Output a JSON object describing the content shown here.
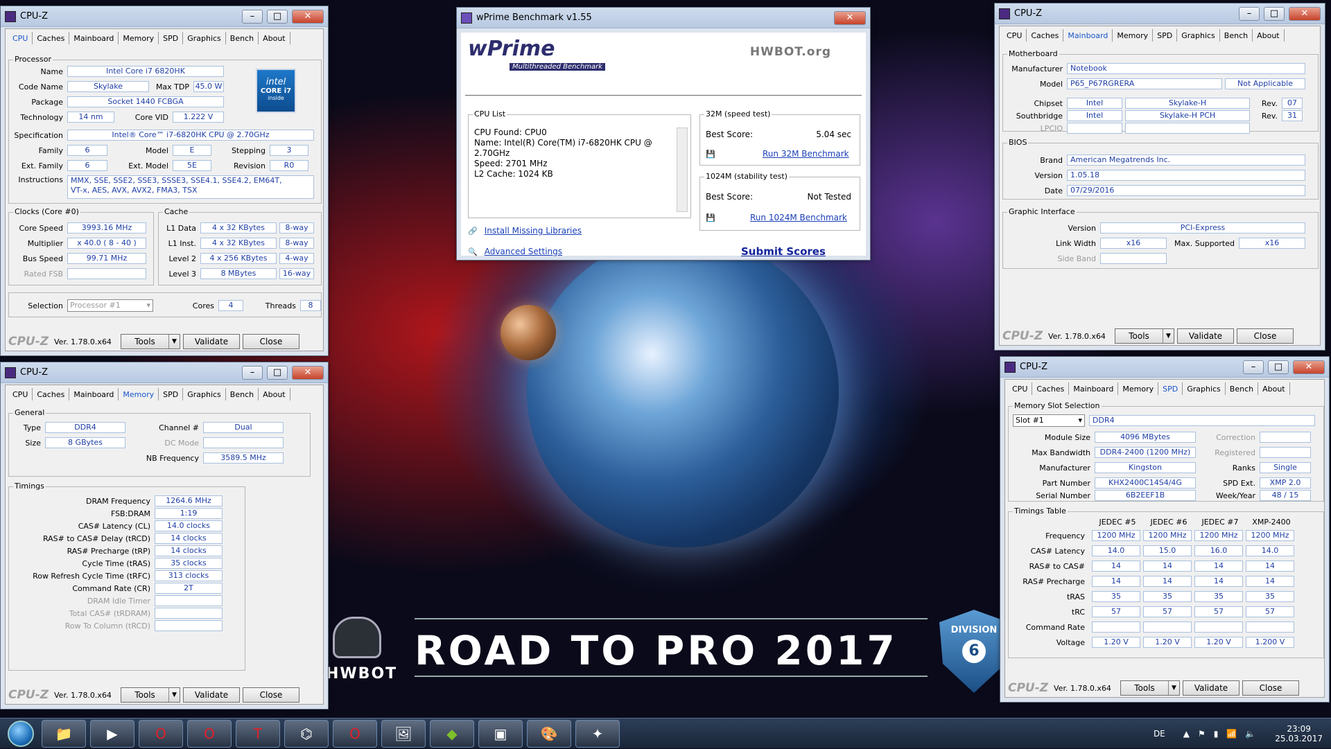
{
  "desktop": {
    "road_text": "ROAD TO PRO 2017",
    "hwbot_text": "HWBOT",
    "division_label": "DIVISION",
    "division_num": "6"
  },
  "cpuz_common": {
    "logo": "CPU-Z",
    "version": "Ver. 1.78.0.x64",
    "tools": "Tools",
    "validate": "Validate",
    "close": "Close",
    "title": "CPU-Z",
    "tabs": [
      "CPU",
      "Caches",
      "Mainboard",
      "Memory",
      "SPD",
      "Graphics",
      "Bench",
      "About"
    ]
  },
  "cpu": {
    "processor_label": "Processor",
    "name_label": "Name",
    "name": "Intel Core i7 6820HK",
    "codename_label": "Code Name",
    "codename": "Skylake",
    "maxtdp_label": "Max TDP",
    "maxtdp": "45.0 W",
    "package_label": "Package",
    "package": "Socket 1440 FCBGA",
    "technology_label": "Technology",
    "technology": "14 nm",
    "corevid_label": "Core VID",
    "corevid": "1.222 V",
    "spec_label": "Specification",
    "spec": "Intel® Core™ i7-6820HK CPU @ 2.70GHz",
    "family_label": "Family",
    "family": "6",
    "model_label": "Model",
    "model": "E",
    "stepping_label": "Stepping",
    "stepping": "3",
    "extfamily_label": "Ext. Family",
    "extfamily": "6",
    "extmodel_label": "Ext. Model",
    "extmodel": "5E",
    "revision_label": "Revision",
    "revision": "R0",
    "instructions_label": "Instructions",
    "instructions1": "MMX, SSE, SSE2, SSE3, SSSE3, SSE4.1, SSE4.2, EM64T,",
    "instructions2": "VT-x, AES, AVX, AVX2, FMA3, TSX",
    "intel_line1": "intel",
    "intel_line2": "CORE i7",
    "intel_line3": "inside",
    "clocks_label": "Clocks (Core #0)",
    "corespeed_label": "Core Speed",
    "corespeed": "3993.16 MHz",
    "multiplier_label": "Multiplier",
    "multiplier": "x 40.0 ( 8 - 40 )",
    "busspeed_label": "Bus Speed",
    "busspeed": "99.71 MHz",
    "ratedfsb_label": "Rated FSB",
    "cache_label": "Cache",
    "l1data_label": "L1 Data",
    "l1data": "4 x 32 KBytes",
    "l1data_way": "8-way",
    "l1inst_label": "L1 Inst.",
    "l1inst": "4 x 32 KBytes",
    "l1inst_way": "8-way",
    "l2_label": "Level 2",
    "l2": "4 x 256 KBytes",
    "l2_way": "4-way",
    "l3_label": "Level 3",
    "l3": "8 MBytes",
    "l3_way": "16-way",
    "selection_label": "Selection",
    "selection": "Processor #1",
    "cores_label": "Cores",
    "cores": "4",
    "threads_label": "Threads",
    "threads": "8"
  },
  "memory": {
    "general_label": "General",
    "type_label": "Type",
    "type": "DDR4",
    "channel_label": "Channel #",
    "channel": "Dual",
    "size_label": "Size",
    "size": "8 GBytes",
    "dcmode_label": "DC Mode",
    "nbfreq_label": "NB Frequency",
    "nbfreq": "3589.5 MHz",
    "timings_label": "Timings",
    "rows": [
      {
        "label": "DRAM Frequency",
        "value": "1264.6 MHz",
        "gray": false
      },
      {
        "label": "FSB:DRAM",
        "value": "1:19",
        "gray": false
      },
      {
        "label": "CAS# Latency (CL)",
        "value": "14.0 clocks",
        "gray": false
      },
      {
        "label": "RAS# to CAS# Delay (tRCD)",
        "value": "14 clocks",
        "gray": false
      },
      {
        "label": "RAS# Precharge (tRP)",
        "value": "14 clocks",
        "gray": false
      },
      {
        "label": "Cycle Time (tRAS)",
        "value": "35 clocks",
        "gray": false
      },
      {
        "label": "Row Refresh Cycle Time (tRFC)",
        "value": "313 clocks",
        "gray": false
      },
      {
        "label": "Command Rate (CR)",
        "value": "2T",
        "gray": false
      },
      {
        "label": "DRAM Idle Timer",
        "value": "",
        "gray": true
      },
      {
        "label": "Total CAS# (tRDRAM)",
        "value": "",
        "gray": true
      },
      {
        "label": "Row To Column (tRCD)",
        "value": "",
        "gray": true
      }
    ]
  },
  "mainboard": {
    "mb_label": "Motherboard",
    "manufacturer_label": "Manufacturer",
    "manufacturer": "Notebook",
    "model_label": "Model",
    "model": "P65_P67RGRERA",
    "model2": "Not Applicable",
    "chipset_label": "Chipset",
    "chipset_vendor": "Intel",
    "chipset": "Skylake-H",
    "chipset_rev_label": "Rev.",
    "chipset_rev": "07",
    "southbridge_label": "Southbridge",
    "sb_vendor": "Intel",
    "sb": "Skylake-H PCH",
    "sb_rev_label": "Rev.",
    "sb_rev": "31",
    "lpcio_label": "LPCIO",
    "bios_label": "BIOS",
    "brand_label": "Brand",
    "brand": "American Megatrends Inc.",
    "version_label": "Version",
    "version": "1.05.18",
    "date_label": "Date",
    "date": "07/29/2016",
    "gi_label": "Graphic Interface",
    "giversion_label": "Version",
    "giversion": "PCI-Express",
    "linkwidth_label": "Link Width",
    "linkwidth": "x16",
    "maxsup_label": "Max. Supported",
    "maxsup": "x16",
    "sideband_label": "Side Band"
  },
  "spd": {
    "slot_label": "Memory Slot Selection",
    "slot": "Slot #1",
    "slot_type": "DDR4",
    "modsize_label": "Module Size",
    "modsize": "4096 MBytes",
    "correction_label": "Correction",
    "maxbw_label": "Max Bandwidth",
    "maxbw": "DDR4-2400 (1200 MHz)",
    "registered_label": "Registered",
    "manuf_label": "Manufacturer",
    "manuf": "Kingston",
    "ranks_label": "Ranks",
    "ranks": "Single",
    "part_label": "Part Number",
    "part": "KHX2400C14S4/4G",
    "spdext_label": "SPD Ext.",
    "spdext": "XMP 2.0",
    "serial_label": "Serial Number",
    "serial": "6B2EEF1B",
    "week_label": "Week/Year",
    "week": "48 / 15",
    "tt_label": "Timings Table",
    "cols": [
      "JEDEC #5",
      "JEDEC #6",
      "JEDEC #7",
      "XMP-2400"
    ],
    "trows": [
      {
        "label": "Frequency",
        "v": [
          "1200 MHz",
          "1200 MHz",
          "1200 MHz",
          "1200 MHz"
        ]
      },
      {
        "label": "CAS# Latency",
        "v": [
          "14.0",
          "15.0",
          "16.0",
          "14.0"
        ]
      },
      {
        "label": "RAS# to CAS#",
        "v": [
          "14",
          "14",
          "14",
          "14"
        ]
      },
      {
        "label": "RAS# Precharge",
        "v": [
          "14",
          "14",
          "14",
          "14"
        ]
      },
      {
        "label": "tRAS",
        "v": [
          "35",
          "35",
          "35",
          "35"
        ]
      },
      {
        "label": "tRC",
        "v": [
          "57",
          "57",
          "57",
          "57"
        ]
      },
      {
        "label": "Command Rate",
        "v": [
          "",
          "",
          "",
          ""
        ]
      },
      {
        "label": "Voltage",
        "v": [
          "1.20 V",
          "1.20 V",
          "1.20 V",
          "1.200 V"
        ]
      }
    ]
  },
  "wprime": {
    "title": "wPrime Benchmark v1.55",
    "logo": "wPrime",
    "sub": "Multithreaded Benchmark",
    "hwbot": "HWBOT.org",
    "cpulist_label": "CPU List",
    "cpulist": [
      "CPU Found: CPU0",
      "Name:   Intel(R) Core(TM) i7-6820HK CPU @",
      "2.70GHz",
      "Speed:  2701 MHz",
      "L2 Cache: 1024 KB"
    ],
    "t32_label": "32M (speed test)",
    "best_label": "Best Score:",
    "t32_score": "5.04 sec",
    "run32": "Run 32M Benchmark",
    "t1024_label": "1024M (stability test)",
    "t1024_score": "Not Tested",
    "run1024": "Run 1024M Benchmark",
    "install": "Install Missing Libraries",
    "advanced": "Advanced Settings",
    "submit": "Submit Scores"
  },
  "taskbar": {
    "lang": "DE",
    "time": "23:09",
    "date": "25.03.2017"
  }
}
